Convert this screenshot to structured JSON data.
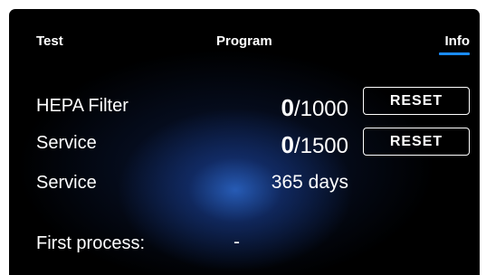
{
  "tabs": {
    "test": "Test",
    "program": "Program",
    "info": "Info"
  },
  "rows": {
    "hepa": {
      "label": "HEPA Filter",
      "count": "0",
      "limit": "/1000",
      "button": "RESET"
    },
    "service_hours": {
      "label": "Service",
      "count": "0",
      "limit": "/1500",
      "button": "RESET"
    },
    "service_days": {
      "label": "Service",
      "value": "365 days"
    },
    "first_process": {
      "label": "First process:",
      "value": "-"
    }
  },
  "colors": {
    "background": "#000000",
    "text": "#ffffff",
    "active_tab_underline": "#1a8cff",
    "glow": "#2c68cd"
  }
}
